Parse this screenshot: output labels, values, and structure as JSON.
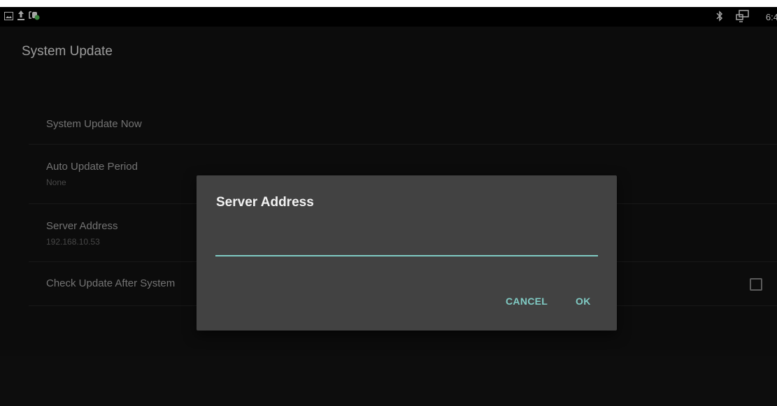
{
  "status_bar": {
    "left_icons": [
      "gallery-icon",
      "upload-icon",
      "usb-debug-icon"
    ],
    "right_icons": [
      "bluetooth-icon",
      "cast-icon"
    ],
    "clock": "6:4"
  },
  "header": {
    "title": "System Update"
  },
  "preferences": [
    {
      "title": "System Update Now",
      "summary": ""
    },
    {
      "title": "Auto Update Period",
      "summary": "None"
    },
    {
      "title": "Server Address",
      "summary": "192.168.10.53"
    },
    {
      "title": "Check Update After System",
      "summary": "",
      "checked": false
    }
  ],
  "dialog": {
    "title": "Server Address",
    "input_value": "",
    "cancel_label": "CANCEL",
    "ok_label": "OK"
  },
  "colors": {
    "accent": "#80cbc4",
    "dialog_bg": "#424242",
    "screen_bg": "#111111"
  }
}
